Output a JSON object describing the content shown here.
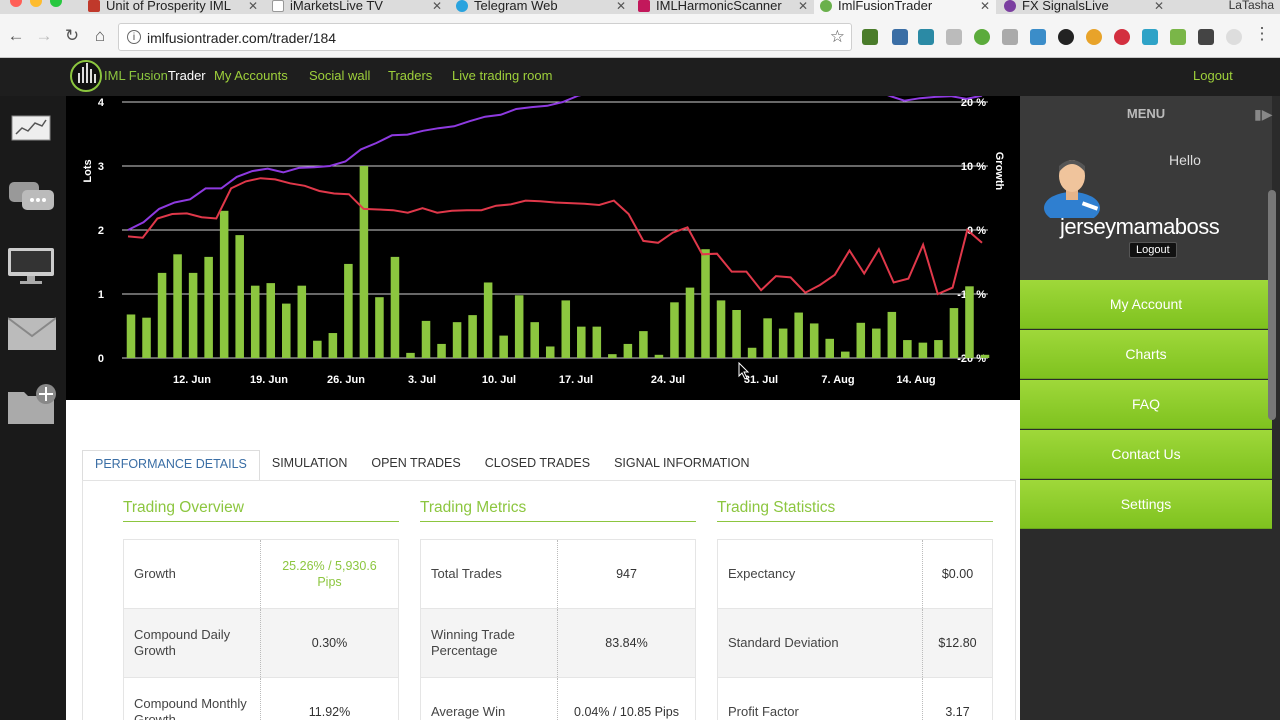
{
  "browser": {
    "tabs": [
      {
        "label": "Unit of Prosperity IML",
        "color": "#c0392b"
      },
      {
        "label": "iMarketsLive TV",
        "color": "#ffffff"
      },
      {
        "label": "Telegram Web",
        "color": "#2aa3de"
      },
      {
        "label": "IMLHarmonicScanner",
        "color": "#c2185b"
      },
      {
        "label": "ImlFusionTrader",
        "color": "#6ab04c"
      },
      {
        "label": "FX SignalsLive",
        "color": "#7b3fa0"
      }
    ],
    "corner_label": "LaTasha",
    "url": "imlfusiontrader.com/trader/184"
  },
  "header": {
    "brand_prefix": "IML Fusion",
    "brand_suffix": "Trader",
    "nav": [
      "My Accounts",
      "Social wall",
      "Traders",
      "Live trading room"
    ],
    "logout": "Logout"
  },
  "chart_data": {
    "type": "bar",
    "ylabel": "Lots",
    "y2label": "Growth",
    "ylim": [
      0,
      4
    ],
    "y2lim": [
      -20,
      20
    ],
    "yticks": [
      "0",
      "1",
      "2",
      "3",
      "4"
    ],
    "y2ticks": [
      "-20 %",
      "-10 %",
      "0 %",
      "10 %",
      "20 %"
    ],
    "xticks": [
      "12. Jun",
      "19. Jun",
      "26. Jun",
      "3. Jul",
      "10. Jul",
      "17. Jul",
      "24. Jul",
      "31. Jul",
      "7. Aug",
      "14. Aug"
    ],
    "lots": [
      0.68,
      0.63,
      1.33,
      1.62,
      1.33,
      1.58,
      2.3,
      1.92,
      1.13,
      1.17,
      0.85,
      1.13,
      0.27,
      0.39,
      1.47,
      3.0,
      0.95,
      1.58,
      0.08,
      0.58,
      0.22,
      0.56,
      0.67,
      1.18,
      0.35,
      0.98,
      0.56,
      0.18,
      0.9,
      0.49,
      0.49,
      0.06,
      0.22,
      0.42,
      0.05,
      0.87,
      1.1,
      1.7,
      0.9,
      0.75,
      0.16,
      0.62,
      0.46,
      0.71,
      0.54,
      0.3,
      0.1,
      0.55,
      0.46,
      0.72,
      0.28,
      0.24,
      0.28,
      0.78,
      1.12,
      0.05
    ],
    "series": [
      {
        "name": "purple",
        "color": "#8e3ae0",
        "values": [
          0,
          1.2,
          3.3,
          4.3,
          4.8,
          6.5,
          6.5,
          8.3,
          9.2,
          9.6,
          9.0,
          9.7,
          9.8,
          10.0,
          10.7,
          12.6,
          13.6,
          14.8,
          14.9,
          15.5,
          15.9,
          16.2,
          17.0,
          17.7,
          18.0,
          18.9,
          19.2,
          19.4,
          20.0,
          21.0,
          21.5,
          22.0,
          22.5,
          23.0,
          23.5,
          24.0,
          24.3,
          23.8,
          24.5,
          24.2,
          23.0,
          22.0,
          22.5,
          22.0,
          21.4,
          22.0,
          21.8,
          22.5,
          22.0,
          21.0,
          20.2,
          20.6,
          20.8,
          20.9,
          20.5,
          21.0
        ]
      },
      {
        "name": "red",
        "color": "#e0384a",
        "values": [
          -1.0,
          -1.2,
          1.8,
          2.5,
          2.6,
          2.0,
          1.8,
          6.5,
          7.6,
          8.1,
          7.9,
          7.3,
          6.9,
          6.1,
          5.7,
          5.6,
          3.3,
          3.2,
          3.1,
          2.7,
          3.4,
          2.7,
          3.0,
          3.1,
          3.1,
          3.8,
          4.0,
          4.6,
          4.5,
          4.3,
          4.2,
          4.1,
          3.9,
          4.6,
          2.5,
          -1.7,
          -2.0,
          -0.4,
          0.4,
          -3.8,
          -3.7,
          -6.5,
          -6.5,
          -9.4,
          -7.2,
          -7.4,
          -9.8,
          -8.6,
          -7.0,
          -3.2,
          -6.8,
          -3.0,
          -8.2,
          -7.6,
          -2.3,
          -10.0,
          -9.0,
          0.0,
          -2.0
        ]
      }
    ]
  },
  "panel": {
    "tabs": [
      "PERFORMANCE DETAILS",
      "SIMULATION",
      "OPEN TRADES",
      "CLOSED TRADES",
      "SIGNAL INFORMATION"
    ],
    "overview": {
      "title": "Trading Overview",
      "rows": [
        {
          "label": "Growth",
          "value": "25.26% / 5,930.6 Pips"
        },
        {
          "label": "Compound Daily Growth",
          "value": "0.30%"
        },
        {
          "label": "Compound Monthly Growth",
          "value": "11.92%"
        }
      ]
    },
    "metrics": {
      "title": "Trading Metrics",
      "rows": [
        {
          "label": "Total Trades",
          "value": "947"
        },
        {
          "label": "Winning Trade Percentage",
          "value": "83.84%"
        },
        {
          "label": "Average Win",
          "value": "0.04% / 10.85 Pips"
        }
      ]
    },
    "statistics": {
      "title": "Trading Statistics",
      "rows": [
        {
          "label": "Expectancy",
          "value": "$0.00"
        },
        {
          "label": "Standard Deviation",
          "value": "$12.80"
        },
        {
          "label": "Profit Factor",
          "value": "3.17"
        }
      ]
    }
  },
  "sidebar": {
    "menu_title": "MENU",
    "hello": "Hello",
    "username": "jerseymamaboss",
    "logout": "Logout",
    "items": [
      "My Account",
      "Charts",
      "FAQ",
      "Contact Us",
      "Settings"
    ]
  },
  "colors": {
    "accent": "#8cc63f",
    "sidebar_green": "#8fcc2c"
  }
}
